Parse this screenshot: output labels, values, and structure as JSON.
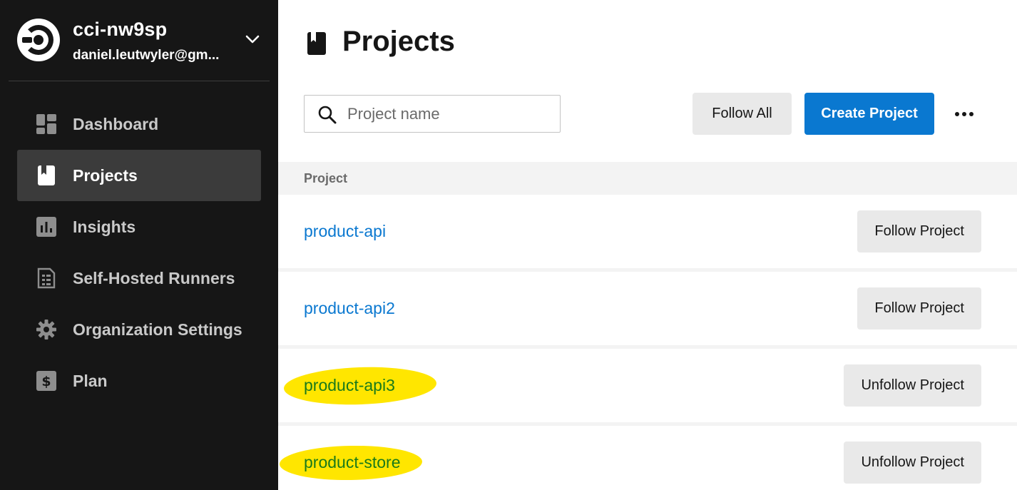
{
  "org": {
    "name": "cci-nw9sp",
    "email": "daniel.leutwyler@gm..."
  },
  "nav": {
    "items": [
      {
        "label": "Dashboard",
        "icon": "dashboard-icon"
      },
      {
        "label": "Projects",
        "icon": "projects-icon",
        "active": true
      },
      {
        "label": "Insights",
        "icon": "insights-icon"
      },
      {
        "label": "Self-Hosted Runners",
        "icon": "runners-icon"
      },
      {
        "label": "Organization Settings",
        "icon": "gear-icon"
      },
      {
        "label": "Plan",
        "icon": "dollar-icon"
      }
    ]
  },
  "page": {
    "title": "Projects"
  },
  "search": {
    "placeholder": "Project name",
    "value": ""
  },
  "toolbar": {
    "follow_all_label": "Follow All",
    "create_label": "Create Project"
  },
  "table": {
    "header": "Project",
    "rows": [
      {
        "name": "product-api",
        "action": "Follow Project",
        "followed": false
      },
      {
        "name": "product-api2",
        "action": "Follow Project",
        "followed": false
      },
      {
        "name": "product-api3",
        "action": "Unfollow Project",
        "followed": true
      },
      {
        "name": "product-store",
        "action": "Unfollow Project",
        "followed": true
      }
    ]
  },
  "colors": {
    "sidebar_bg": "#161616",
    "accent_blue": "#0a78d0",
    "followed_green": "#1a7a1a",
    "highlight_yellow": "#ffe600"
  }
}
